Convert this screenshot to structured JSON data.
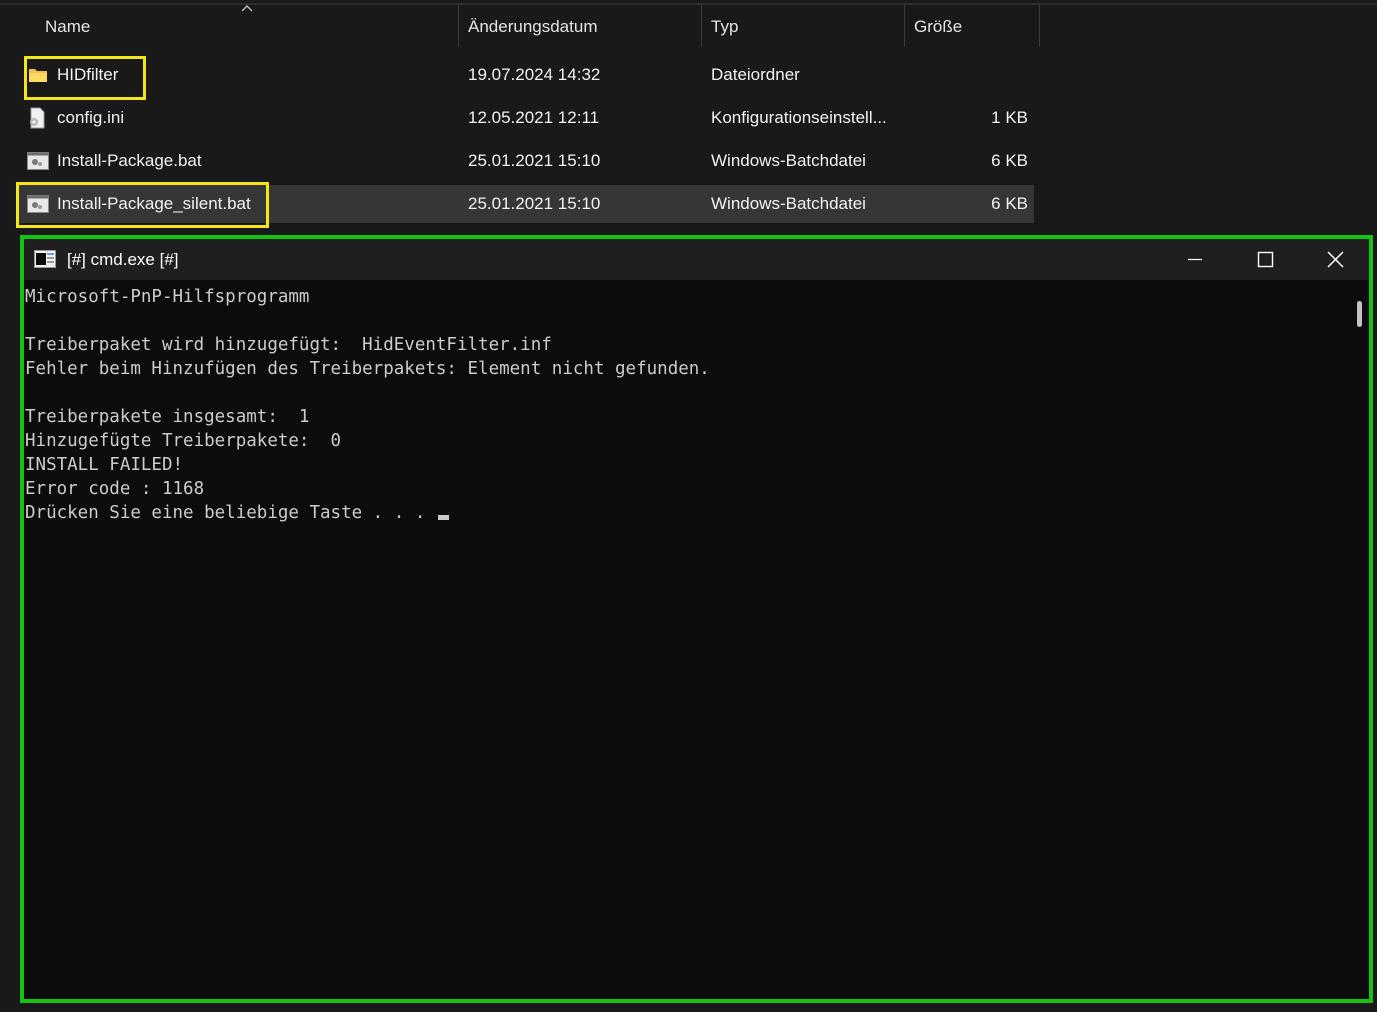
{
  "explorer": {
    "columns": {
      "name": "Name",
      "date": "Änderungsdatum",
      "type": "Typ",
      "size": "Größe"
    },
    "sort_indicator_icon": "chevron-up-icon",
    "files": [
      {
        "name": "HIDfilter",
        "date": "19.07.2024 14:32",
        "type": "Dateiordner",
        "size": "",
        "icon": "folder-icon"
      },
      {
        "name": "config.ini",
        "date": "12.05.2021 12:11",
        "type": "Konfigurationseinstell...",
        "size": "1 KB",
        "icon": "settings-file-icon"
      },
      {
        "name": "Install-Package.bat",
        "date": "25.01.2021 15:10",
        "type": "Windows-Batchdatei",
        "size": "6 KB",
        "icon": "batch-file-icon"
      },
      {
        "name": "Install-Package_silent.bat",
        "date": "25.01.2021 15:10",
        "type": "Windows-Batchdatei",
        "size": "6 KB",
        "icon": "batch-file-icon",
        "selected": true
      }
    ]
  },
  "cmd": {
    "title": "[#] cmd.exe [#]",
    "icon": "console-window-icon",
    "lines": [
      "Microsoft-PnP-Hilfsprogramm",
      "",
      "Treiberpaket wird hinzugefügt:  HidEventFilter.inf",
      "Fehler beim Hinzufügen des Treiberpakets: Element nicht gefunden.",
      "",
      "Treiberpakete insgesamt:  1",
      "Hinzugefügte Treiberpakete:  0",
      "INSTALL FAILED!",
      "Error code : 1168",
      "Drücken Sie eine beliebige Taste . . . "
    ]
  },
  "colors": {
    "background": "#191919",
    "selected_row": "#363636",
    "highlight_yellow": "#f5e61b",
    "highlight_green": "#15c315",
    "console_bg": "#0c0c0c",
    "console_text": "#cccccc"
  }
}
